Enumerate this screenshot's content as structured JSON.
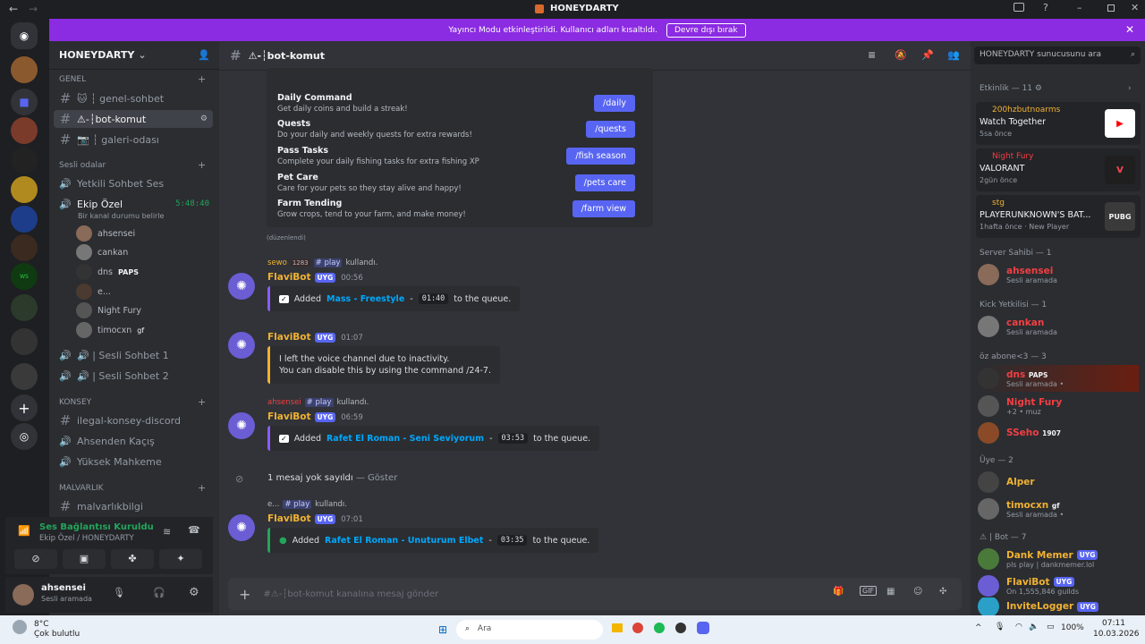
{
  "window": {
    "title": "HONEYDARTY"
  },
  "banner": {
    "text": "Yayıncı Modu etkinleştirildi. Kullanıcı adları kısaltıldı.",
    "button": "Devre dışı bırak"
  },
  "server": {
    "name": "HONEYDARTY"
  },
  "sidebar": {
    "categories": {
      "genel": "GENEL",
      "sesli": "Sesli odalar",
      "konsey": "KONSEY",
      "malvarlik": "MALVARLIK"
    },
    "text_channels": [
      "🐱 ┆ genel-sohbet",
      "⚠-┆bot-komut",
      "📷 ┆ galeri-odası"
    ],
    "voice1": "Yetkili Sohbet Ses",
    "voice2": "Ekip Özel",
    "voice2_time": "5:48:40",
    "voice2_status": "Bir kanal durumu belirle",
    "voice_users": [
      "ahsensei",
      "cankan",
      "dns",
      "e...",
      "Night Fury",
      "timocxn"
    ],
    "voice_user_tags": {
      "dns": "PAPS",
      "timocxn": "gf"
    },
    "voice3": "🔊 | Sesli Sohbet 1",
    "voice4": "🔊 | Sesli Sohbet 2",
    "konsey": [
      "ilegal-konsey-discord",
      "Ahsenden Kaçış",
      "Yüksek Mahkeme"
    ],
    "malvarlik": [
      "malvarlıkbilgi"
    ]
  },
  "voice_panel": {
    "status": "Ses Bağlantısı Kuruldu",
    "where": "Ekip Özel / HONEYDARTY"
  },
  "user_panel": {
    "name": "ahsensei",
    "status": "Sesli aramada"
  },
  "chat": {
    "channel": "⚠-┆bot-komut",
    "commands": [
      {
        "title": "Daily Command",
        "desc": "Get daily coins and build a streak!",
        "btn": "/daily"
      },
      {
        "title": "Quests",
        "desc": "Do your daily and weekly quests for extra rewards!",
        "btn": "/quests"
      },
      {
        "title": "Pass Tasks",
        "desc": "Complete your daily fishing tasks for extra fishing XP",
        "btn": "/fish season"
      },
      {
        "title": "Pet Care",
        "desc": "Care for your pets so they stay alive and happy!",
        "btn": "/pets care"
      },
      {
        "title": "Farm Tending",
        "desc": "Grow crops, tend to your farm, and make money!",
        "btn": "/farm view"
      }
    ],
    "edited": "(düzenlendi)",
    "bot_name": "FlaviBot",
    "bot_tag": "UYG",
    "messages": [
      {
        "reply_user": "sewo",
        "reply_badge": "1283",
        "reply_cmd": "# play",
        "reply_suffix": "kullandı.",
        "time": "00:56",
        "pre": "Added",
        "song": "Mass - Freestyle",
        "sep": "-",
        "dur": "01:40",
        "post": "to the queue."
      },
      {
        "time": "01:07",
        "line1": "I left the voice channel due to inactivity.",
        "line2": "You can disable this by using the command /24-7."
      },
      {
        "reply_user": "ahsensei",
        "reply_cmd": "# play",
        "reply_suffix": "kullandı.",
        "time": "06:59",
        "pre": "Added",
        "song": "Rafet El Roman - Seni Seviyorum",
        "sep": "-",
        "dur": "03:53",
        "post": "to the queue."
      },
      {
        "reply_user": "e...",
        "reply_cmd": "# play",
        "reply_suffix": "kullandı.",
        "time": "07:01",
        "pre": "Added",
        "song": "Rafet El Roman - Unuturum Elbet",
        "sep": "-",
        "dur": "03:35",
        "post": "to the queue."
      }
    ],
    "ignored": "1 mesaj yok sayıldı",
    "ignored_show": "— Göster",
    "input_placeholder": "#⚠-┆bot-komut kanalına mesaj gönder"
  },
  "members": {
    "search": "HONEYDARTY sunucusunu ara",
    "activity_head": "Etkinlik — 11",
    "activities": [
      {
        "user": "200hzbutnoarms",
        "title": "Watch Together",
        "time": "5sa önce",
        "icon": "▶"
      },
      {
        "user": "Night Fury",
        "title": "VALORANT",
        "time": "2gün önce",
        "icon": "V"
      },
      {
        "user": "stg",
        "title": "PLAYERUNKNOWN'S BAT...",
        "time": "1hafta önce",
        "extra": "New Player",
        "icon": "PUBG"
      }
    ],
    "groups": [
      {
        "head": "Server Sahibi — 1",
        "items": [
          {
            "name": "ahsensei",
            "status": "Sesli aramada",
            "color": "#f23f43"
          }
        ]
      },
      {
        "head": "Kick Yetkilisi — 1",
        "items": [
          {
            "name": "cankan",
            "status": "Sesli aramada",
            "color": "#f23f43"
          }
        ]
      },
      {
        "head": "öz abone<3 — 3",
        "items": [
          {
            "name": "dns",
            "status": "Sesli aramada •",
            "color": "#f23f43",
            "tag": "PAPS"
          },
          {
            "name": "Night Fury",
            "status": "+2 • muz",
            "color": "#f23f43"
          },
          {
            "name": "SSeho",
            "status": "",
            "color": "#f23f43",
            "tag": "1907"
          }
        ]
      },
      {
        "head": "Üye — 2",
        "items": [
          {
            "name": "Alper",
            "status": "",
            "color": "#f0b232"
          },
          {
            "name": "timocxn",
            "status": "Sesli aramada •",
            "color": "#f0b232",
            "tag": "gf"
          }
        ]
      },
      {
        "head": "⚠ | Bot — 7",
        "items": [
          {
            "name": "Dank Memer",
            "status": "pls play | dankmemer.lol",
            "color": "#f0b232",
            "tag": "UYG"
          },
          {
            "name": "FlaviBot",
            "status": "On 1,555,846 guilds",
            "color": "#f0b232",
            "tag": "UYG"
          },
          {
            "name": "InviteLogger",
            "status": "",
            "color": "#f0b232",
            "tag": "UYG"
          }
        ]
      }
    ]
  },
  "taskbar": {
    "temp": "8°C",
    "weather": "Çok bulutlu",
    "search": "Ara",
    "battery": "100%",
    "time": "07:11",
    "date": "10.03.2026"
  },
  "colors": {
    "accent": "#5865f2",
    "banner": "#8b2be2",
    "bot_name": "#f0b232",
    "red_name": "#f23f43"
  }
}
